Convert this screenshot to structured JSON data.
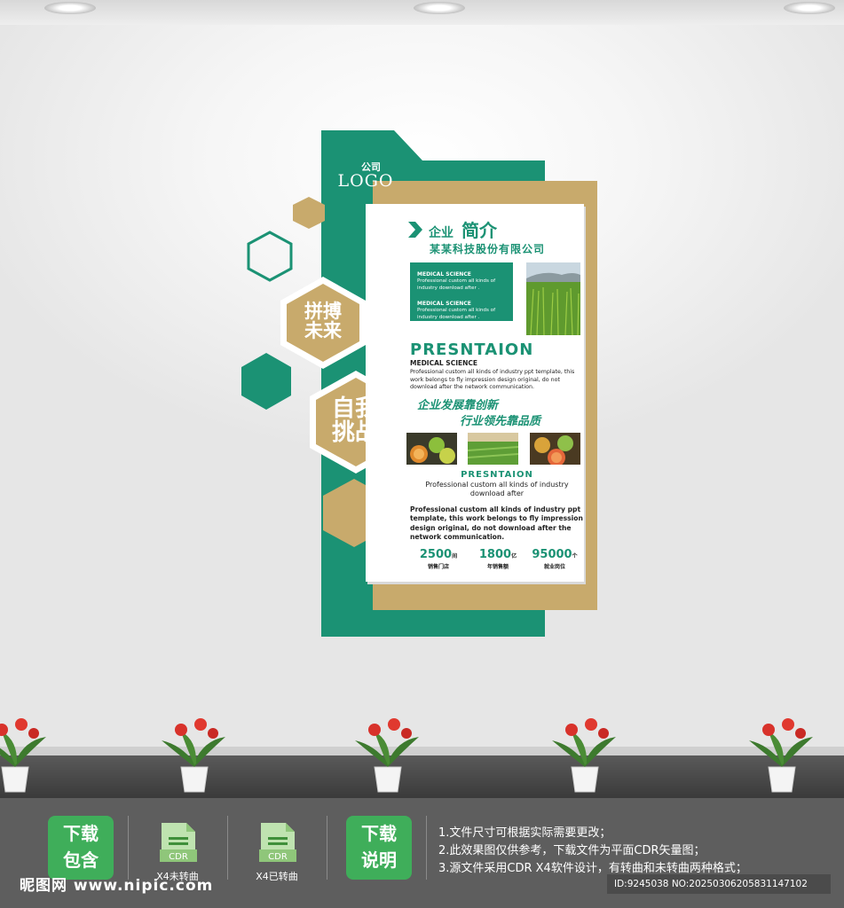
{
  "poster": {
    "logo_small": "公司",
    "logo_big": "LOGO",
    "hex_slogan_1": "拼搏\n未来",
    "hex_slogan_2": "自我\n挑战",
    "title_small": "企业",
    "title_big": "简介",
    "company": "某某科技股份有限公司",
    "box_title_1": "MEDICAL SCIENCE",
    "box_text_1": "Professional custom all kinds of industry download after .",
    "box_title_2": "MEDICAL SCIENCE",
    "box_text_2": "Professional custom all kinds of industry download after .",
    "heading_big": "PRESNTAION",
    "medical_science": "MEDICAL SCIENCE",
    "paragraph_1": "Professional custom all kinds of industry ppt template, this work belongs to fly impression design original, do not download after the network communication.",
    "slogan_1": "企业发展靠创新",
    "slogan_2": "行业领先靠品质",
    "heading_small": "PRESNTAION",
    "subheading": "Professional custom all kinds of industry download after",
    "paragraph_2": "Professional custom all kinds of industry ppt template, this work belongs to fly impression design original, do not download after the network communication.",
    "stats": [
      {
        "value": "2500",
        "unit": "间",
        "label": "销售门店"
      },
      {
        "value": "1800",
        "unit": "亿",
        "label": "年销售额"
      },
      {
        "value": "95000",
        "unit": "个",
        "label": "就业岗位"
      }
    ]
  },
  "footer": {
    "badge_contents": "下载\n包含",
    "badge_notes": "下载\n说明",
    "file_1_icon_text": "CDR",
    "file_1_label": "X4未转曲",
    "file_2_icon_text": "CDR",
    "file_2_label": "X4已转曲",
    "notes": [
      "1.文件尺寸可根据实际需要更改；",
      "2.此效果图仅供参考，下载文件为平面CDR矢量图；",
      "3.源文件采用CDR X4软件设计，有转曲和未转曲两种格式；"
    ],
    "watermark": "昵图网 www.nipic.com",
    "id_line": "ID:9245038 NO:20250306205831147102"
  },
  "colors": {
    "brand_green": "#1b9274",
    "brand_gold": "#c8aa6c",
    "badge_green": "#3fae5a"
  }
}
